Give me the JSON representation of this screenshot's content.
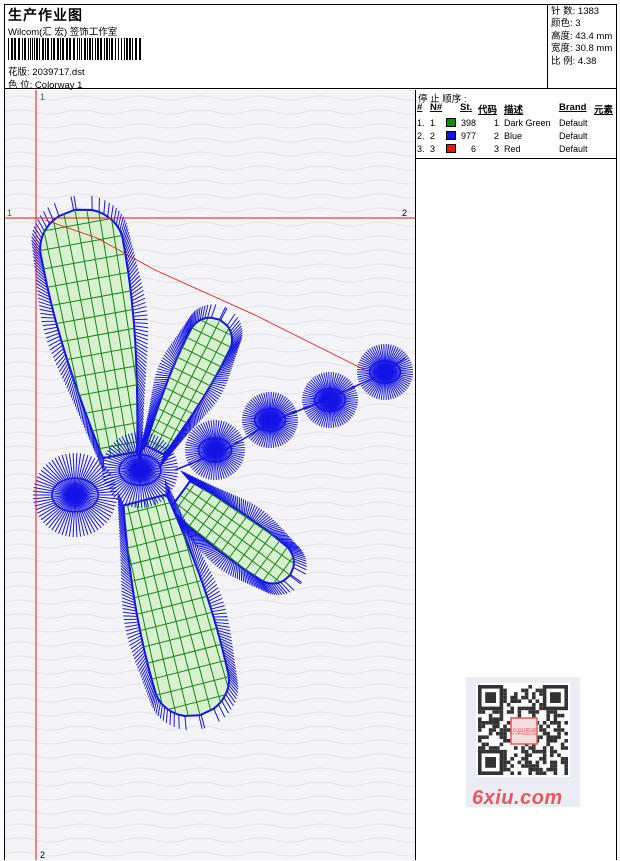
{
  "header": {
    "title": "生产作业图",
    "company": "Wilcom(汇 宏) 签饰工作室",
    "filename_label": "花版:",
    "filename": "2039717.dst",
    "colorway_label": "色 位:",
    "colorway": "Colorway 1"
  },
  "stats": [
    {
      "label": "针 数:",
      "value": "1383"
    },
    {
      "label": "颜色:",
      "value": "3"
    },
    {
      "label": "高度:",
      "value": "43.4 mm"
    },
    {
      "label": "宽度:",
      "value": "30.8 mm"
    },
    {
      "label": "比 例:",
      "value": "4.38"
    }
  ],
  "stop_sequence": {
    "title": "停 止 顺序 :",
    "columns": [
      "#",
      "N#",
      "St.",
      "代码",
      "描述",
      "Brand",
      "元素"
    ],
    "rows": [
      {
        "num": "1.",
        "needle": "1",
        "color": "#118811",
        "stitches": "398",
        "code": "1",
        "description": "Dark Green",
        "brand": "Default"
      },
      {
        "num": "2.",
        "needle": "2",
        "color": "#1414e6",
        "stitches": "977",
        "code": "2",
        "description": "Blue",
        "brand": "Default"
      },
      {
        "num": "3.",
        "needle": "3",
        "color": "#e81414",
        "stitches": "6",
        "code": "3",
        "description": "Red",
        "brand": "Default"
      }
    ]
  },
  "axis_markers": {
    "top": "1",
    "bottom": "2",
    "left": "1",
    "right": "2"
  },
  "colors": {
    "green": "#118811",
    "blue": "#1414e6",
    "red": "#e81414"
  },
  "watermark": {
    "site": "6xiu.com",
    "stamp": "识码图图"
  }
}
